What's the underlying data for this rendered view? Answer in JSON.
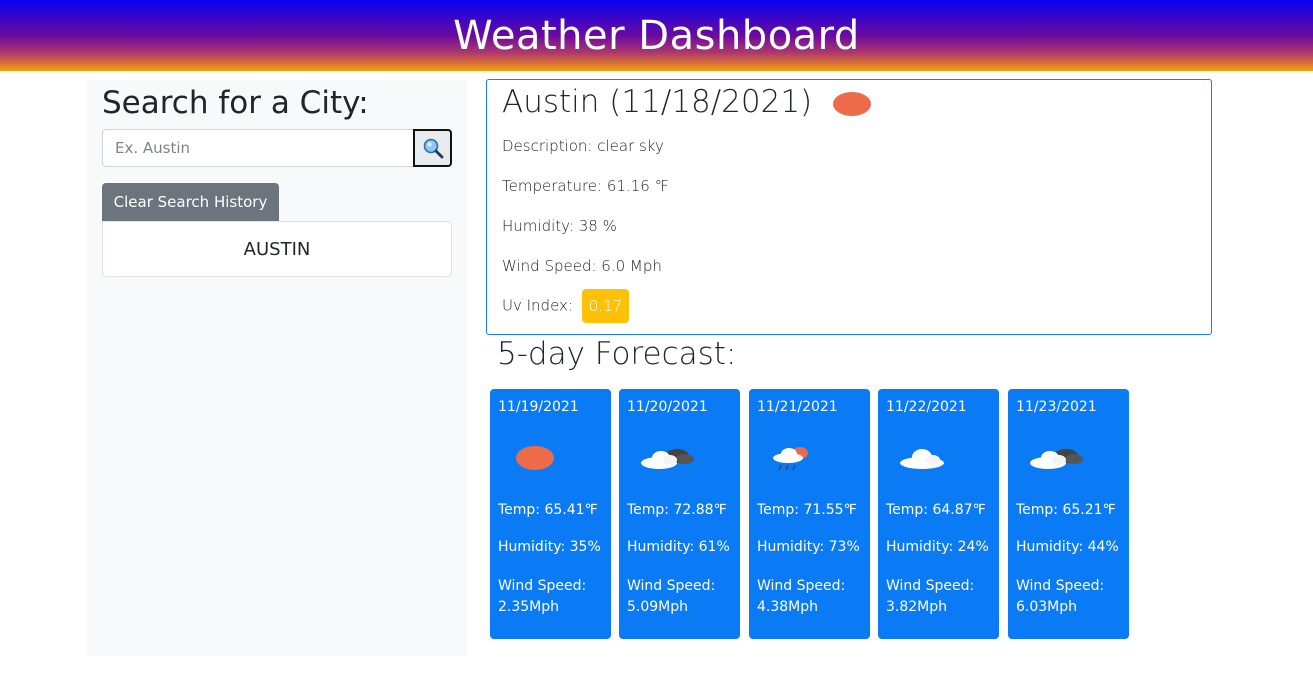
{
  "header": {
    "title": "Weather Dashboard"
  },
  "sidebar": {
    "heading": "Search for a City:",
    "search_placeholder": "Ex. Austin",
    "search_icon": "magnifier-icon",
    "clear_label": "Clear Search History",
    "history": [
      "AUSTIN"
    ]
  },
  "current": {
    "title": "Austin (11/18/2021)",
    "icon": "sun-icon",
    "description": "Description: clear sky",
    "temperature": "Temperature: 61.16 ℉",
    "humidity": "Humidity: 38 %",
    "wind": "Wind Speed: 6.0 Mph",
    "uv_label": "Uv Index:",
    "uv_value": "0.17",
    "uv_color": "#ffc107"
  },
  "forecast": {
    "heading": "5-day Forecast:",
    "days": [
      {
        "date": "11/19/2021",
        "icon": "sun-icon",
        "temp": "Temp: 65.41℉",
        "humidity": "Humidity: 35%",
        "wind": "Wind Speed: 2.35Mph"
      },
      {
        "date": "11/20/2021",
        "icon": "broken-clouds-icon",
        "temp": "Temp: 72.88℉",
        "humidity": "Humidity: 61%",
        "wind": "Wind Speed: 5.09Mph"
      },
      {
        "date": "11/21/2021",
        "icon": "rain-sun-icon",
        "temp": "Temp: 71.55℉",
        "humidity": "Humidity: 73%",
        "wind": "Wind Speed: 4.38Mph"
      },
      {
        "date": "11/22/2021",
        "icon": "cloud-icon",
        "temp": "Temp: 64.87℉",
        "humidity": "Humidity: 24%",
        "wind": "Wind Speed: 3.82Mph"
      },
      {
        "date": "11/23/2021",
        "icon": "broken-clouds-icon",
        "temp": "Temp: 65.21℉",
        "humidity": "Humidity: 44%",
        "wind": "Wind Speed: 6.03Mph"
      }
    ],
    "card_color": "#0a7bf5"
  }
}
